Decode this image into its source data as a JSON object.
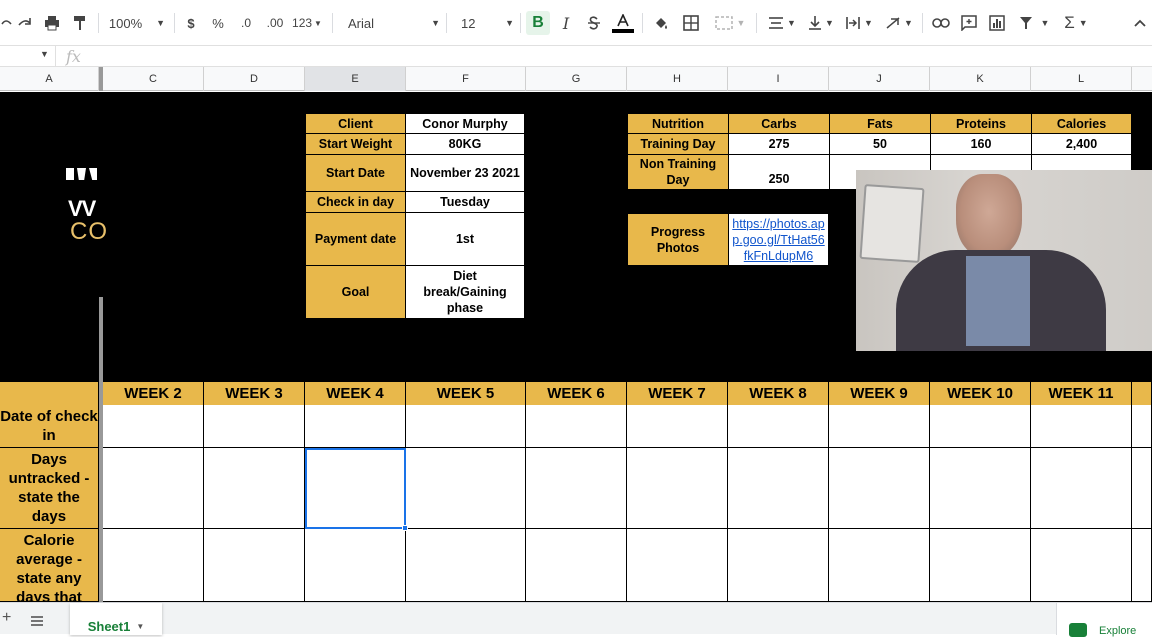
{
  "toolbar": {
    "zoom": "100%",
    "currency": "$",
    "percent": "%",
    "dec_less": ".0",
    "dec_more": ".00",
    "num_format": "123",
    "font": "Arial",
    "font_size": "12",
    "bold": "B",
    "italic": "I"
  },
  "formula": {
    "fx": "fx",
    "value": ""
  },
  "columns": [
    "A",
    "C",
    "D",
    "E",
    "F",
    "G",
    "H",
    "I",
    "J",
    "K",
    "L"
  ],
  "client_table": {
    "rows": [
      {
        "label": "Client",
        "value": "Conor Murphy"
      },
      {
        "label": "Start Weight",
        "value": "80KG"
      },
      {
        "label": "Start Date",
        "value": "November 23 2021"
      },
      {
        "label": "Check in day",
        "value": "Tuesday"
      },
      {
        "label": "Payment date",
        "value": "1st"
      },
      {
        "label": "Goal",
        "value": "Diet break/Gaining phase"
      }
    ]
  },
  "nutrition": {
    "headers": [
      "Nutrition",
      "Carbs",
      "Fats",
      "Proteins",
      "Calories"
    ],
    "training_day": [
      "Training Day",
      "275",
      "50",
      "160",
      "2,400"
    ],
    "non_training_day": [
      "Non Training Day",
      "250"
    ],
    "progress_label": "Progress Photos",
    "progress_link": "https://photos.app.goo.gl/TtHat56fkFnLdupM6"
  },
  "logo": {
    "line1": "VV",
    "line2": "CO"
  },
  "weeks": [
    "WEEK 2",
    "WEEK 3",
    "WEEK 4",
    "WEEK 5",
    "WEEK 6",
    "WEEK 7",
    "WEEK 8",
    "WEEK 9",
    "WEEK 10",
    "WEEK 11"
  ],
  "row_labels": [
    "Date of check in",
    "Days untracked - state the days",
    "Calorie average - state any days that"
  ],
  "sheet_tab": "Sheet1",
  "explore": "Explore",
  "colors": {
    "gold": "#e8b84b",
    "black": "#000000",
    "selection": "#1a73e8",
    "link": "#1155cc"
  }
}
